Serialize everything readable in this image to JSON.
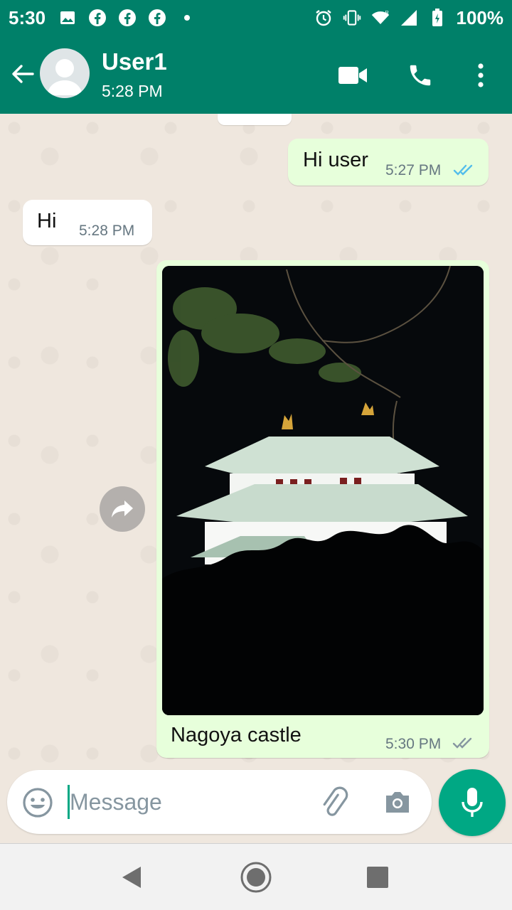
{
  "status_bar": {
    "time": "5:30",
    "battery": "100%",
    "icons_left": [
      "image-icon",
      "facebook-icon",
      "facebook-icon",
      "facebook-icon",
      "dot-icon"
    ],
    "icons_right": [
      "alarm-icon",
      "vibrate-icon",
      "wifi-icon",
      "signal-icon",
      "battery-icon"
    ]
  },
  "header": {
    "contact_name": "User1",
    "last_seen": "5:28 PM",
    "actions": [
      "video-call-icon",
      "phone-call-icon",
      "more-vert-icon"
    ]
  },
  "messages": [
    {
      "direction": "out",
      "text": "Hi user",
      "time": "5:27 PM",
      "status": "read"
    },
    {
      "direction": "in",
      "text": "Hi",
      "time": "5:28 PM"
    },
    {
      "direction": "out",
      "type": "image",
      "caption": "Nagoya castle",
      "time": "5:30 PM",
      "status": "delivered"
    }
  ],
  "composer": {
    "placeholder": "Message",
    "value": ""
  },
  "colors": {
    "header": "#008069",
    "accent": "#00a884",
    "outgoing_bubble": "#e7ffdb",
    "incoming_bubble": "#ffffff",
    "read_tick": "#53bdeb",
    "chat_bg": "#efe7de"
  },
  "nav": [
    "back-triangle-icon",
    "home-circle-icon",
    "recents-square-icon"
  ]
}
